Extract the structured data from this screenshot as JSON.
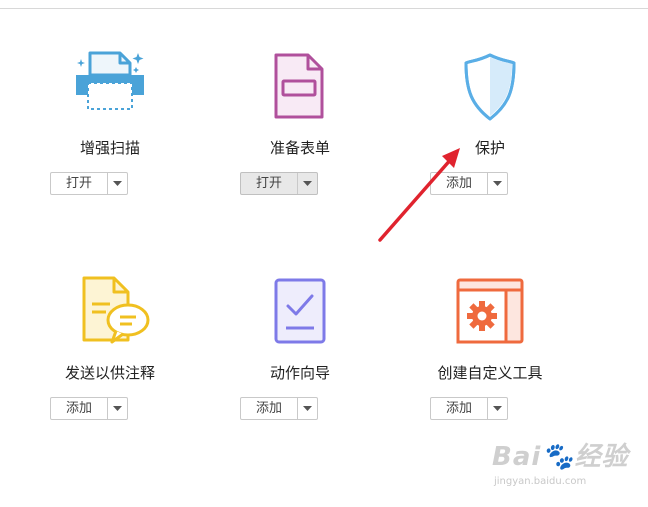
{
  "tools": [
    {
      "name": "增强扫描",
      "button": "打开",
      "icon": "enhance-scan-icon"
    },
    {
      "name": "准备表单",
      "button": "打开",
      "icon": "prepare-form-icon"
    },
    {
      "name": "保护",
      "button": "添加",
      "icon": "protect-shield-icon"
    },
    {
      "name": "发送以供注释",
      "button": "添加",
      "icon": "send-for-comments-icon"
    },
    {
      "name": "动作向导",
      "button": "添加",
      "icon": "action-wizard-icon"
    },
    {
      "name": "创建自定义工具",
      "button": "添加",
      "icon": "create-custom-tool-icon"
    }
  ],
  "colors": {
    "scan": "#4aa3d8",
    "form": "#b0509c",
    "protect": "#5aaee6",
    "comments": "#f0c020",
    "wizard": "#7e7ae8",
    "custom": "#ef6a3e",
    "annotation_arrow": "#e0232e"
  },
  "watermark": {
    "logo": "Bai 经验",
    "url": "jingyan.baidu.com"
  }
}
